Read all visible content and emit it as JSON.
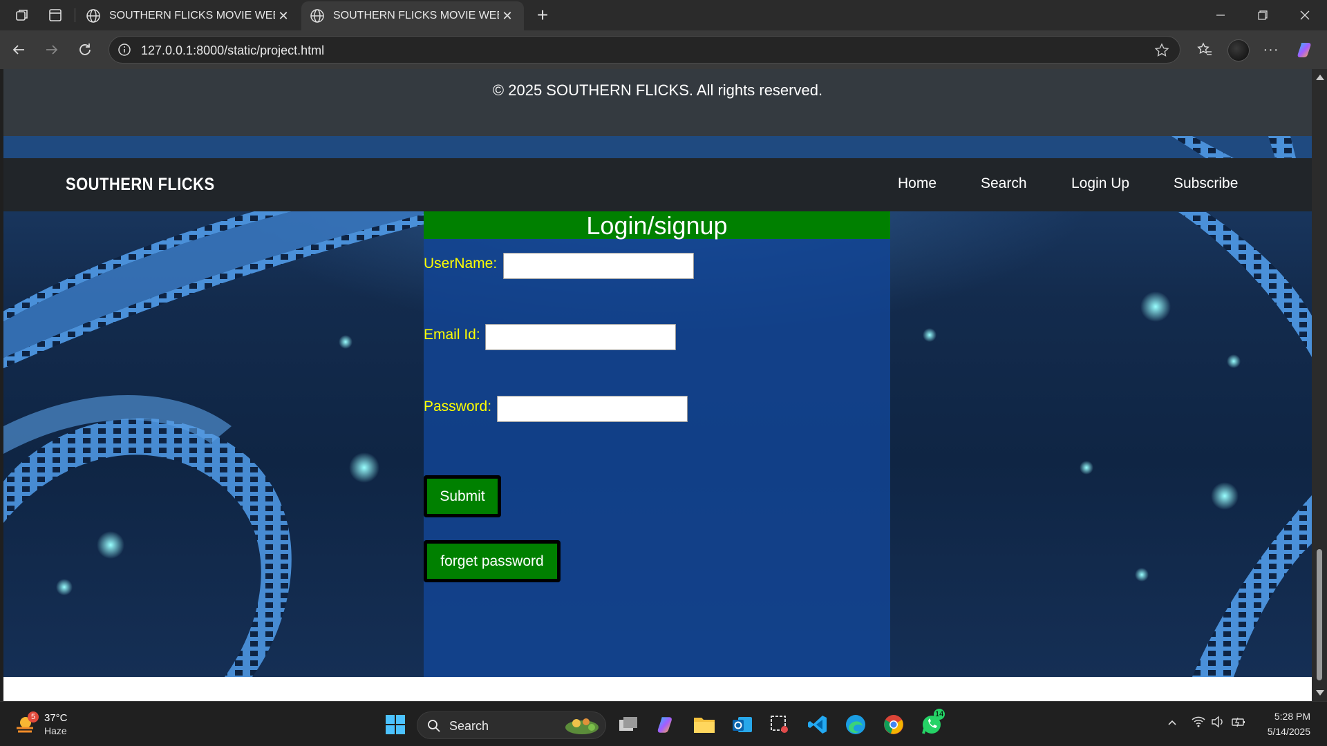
{
  "browser": {
    "tabs": [
      {
        "title": "SOUTHERN FLICKS MOVIE WEBSITE",
        "active": false
      },
      {
        "title": "SOUTHERN FLICKS MOVIE WEBSITE",
        "active": true
      }
    ],
    "url": "127.0.0.1:8000/static/project.html"
  },
  "page": {
    "footer_text": "© 2025 SOUTHERN FLICKS. All rights reserved.",
    "brand": "SOUTHERN FLICKS",
    "menu": [
      "Home",
      "Search",
      "Login Up",
      "Subscribe"
    ],
    "login": {
      "title": "Login/signup",
      "username_label": "UserName:",
      "email_label": "Email Id:",
      "password_label": "Password:",
      "username_value": "",
      "email_value": "",
      "password_value": "",
      "submit_label": "Submit",
      "forget_label": "forget password"
    },
    "colors": {
      "header_bg": "#212529",
      "footer_bg": "#343a40",
      "title_bg": "#008000",
      "label_color": "#ffff00"
    }
  },
  "taskbar": {
    "weather_temp": "37°C",
    "weather_desc": "Haze",
    "weather_badge": "5",
    "search_label": "Search",
    "whatsapp_badge": "14",
    "time": "5:28 PM",
    "date": "5/14/2025"
  }
}
